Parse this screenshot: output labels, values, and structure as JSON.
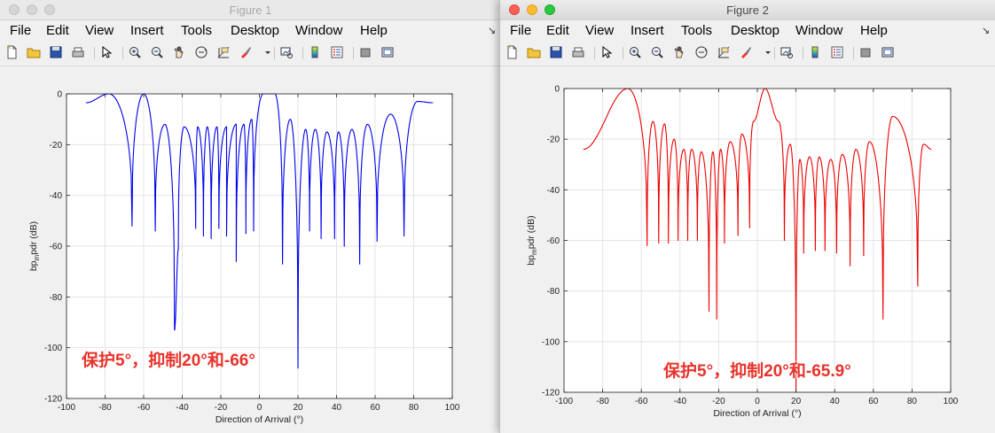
{
  "windows": [
    {
      "title": "Figure 1",
      "menu": [
        "File",
        "Edit",
        "View",
        "Insert",
        "Tools",
        "Desktop",
        "Window",
        "Help"
      ],
      "annotation": "保护5°，抑制20°和-66°",
      "line_color": "#0000ee"
    },
    {
      "title": "Figure 2",
      "menu": [
        "File",
        "Edit",
        "View",
        "Insert",
        "Tools",
        "Desktop",
        "Window",
        "Help"
      ],
      "annotation": "保护5°，抑制20°和-65.9°",
      "line_color": "#ee0000"
    }
  ],
  "menu_overflow_arrow": "↘",
  "chart_data": [
    {
      "type": "line",
      "title": "",
      "xlabel": "Direction of Arrival  (°)",
      "ylabel": "bp_m_pdr (dB)",
      "xlim": [
        -100,
        100
      ],
      "ylim": [
        -120,
        0
      ],
      "xticks": [
        -100,
        -80,
        -60,
        -40,
        -20,
        0,
        20,
        40,
        60,
        80,
        100
      ],
      "yticks": [
        0,
        -20,
        -40,
        -60,
        -80,
        -100,
        -120
      ],
      "grid": true,
      "x_range": [
        -90,
        90
      ],
      "series": [
        {
          "color": "#0000ee",
          "nulls": [
            [
              -66,
              -52
            ],
            [
              -54,
              -54
            ],
            [
              -44,
              -93
            ],
            [
              -42,
              -61
            ],
            [
              -33,
              -53
            ],
            [
              -29,
              -56
            ],
            [
              -25,
              -57
            ],
            [
              -21,
              -53
            ],
            [
              -17,
              -56
            ],
            [
              -12,
              -66
            ],
            [
              -7,
              -55
            ],
            [
              -3,
              -54
            ],
            [
              12,
              -67
            ],
            [
              20,
              -108
            ],
            [
              26,
              -54
            ],
            [
              32,
              -57
            ],
            [
              39,
              -57
            ],
            [
              44,
              -60
            ],
            [
              52,
              -67
            ],
            [
              61,
              -58
            ],
            [
              75,
              -56
            ]
          ],
          "peaks": [
            [
              -90,
              -3.5
            ],
            [
              -78,
              0
            ],
            [
              -60,
              0
            ],
            [
              -49,
              -12
            ],
            [
              -39,
              -13
            ],
            [
              -32,
              -13
            ],
            [
              -27,
              -13
            ],
            [
              -22,
              -13
            ],
            [
              -17,
              -13
            ],
            [
              -12,
              -12
            ],
            [
              -8,
              -12
            ],
            [
              -4,
              -10
            ],
            [
              2,
              0
            ],
            [
              8,
              0
            ],
            [
              16,
              -10
            ],
            [
              24,
              -14
            ],
            [
              29,
              -14
            ],
            [
              35,
              -15
            ],
            [
              41,
              -15
            ],
            [
              48,
              -14
            ],
            [
              56,
              -12
            ],
            [
              68,
              -8
            ],
            [
              82,
              -3
            ],
            [
              90,
              -3.5
            ]
          ]
        },
        {
          "color": "#ee0000",
          "nulls": [
            [
              -57,
              -62
            ],
            [
              -51,
              -61
            ],
            [
              -46,
              -61
            ],
            [
              -41,
              -60
            ],
            [
              -36,
              -60
            ],
            [
              -31,
              -60
            ],
            [
              -25,
              -88
            ],
            [
              -21,
              -91
            ],
            [
              -17,
              -61
            ],
            [
              -10,
              -58
            ],
            [
              -4,
              -55
            ],
            [
              14,
              -60
            ],
            [
              20,
              -120
            ],
            [
              24,
              -65
            ],
            [
              30,
              -64
            ],
            [
              35,
              -64
            ],
            [
              41,
              -65
            ],
            [
              48,
              -70
            ],
            [
              55,
              -66
            ],
            [
              65,
              -91
            ],
            [
              83,
              -78
            ]
          ],
          "peaks": [
            [
              -90,
              -24
            ],
            [
              -67,
              0
            ],
            [
              -54,
              -13
            ],
            [
              -48,
              -14
            ],
            [
              -43,
              -20
            ],
            [
              -38,
              -24
            ],
            [
              -34,
              -24
            ],
            [
              -29,
              -25
            ],
            [
              -23,
              -25
            ],
            [
              -19,
              -24
            ],
            [
              -14,
              -21
            ],
            [
              -8,
              -18
            ],
            [
              -2,
              -13
            ],
            [
              4,
              0
            ],
            [
              11,
              -13
            ],
            [
              17,
              -22
            ],
            [
              22,
              -28
            ],
            [
              27,
              -27
            ],
            [
              32,
              -27
            ],
            [
              38,
              -28
            ],
            [
              44,
              -26
            ],
            [
              51,
              -24
            ],
            [
              58,
              -21
            ],
            [
              70,
              -11
            ],
            [
              86,
              -22
            ],
            [
              90,
              -24
            ]
          ]
        }
      ]
    }
  ]
}
